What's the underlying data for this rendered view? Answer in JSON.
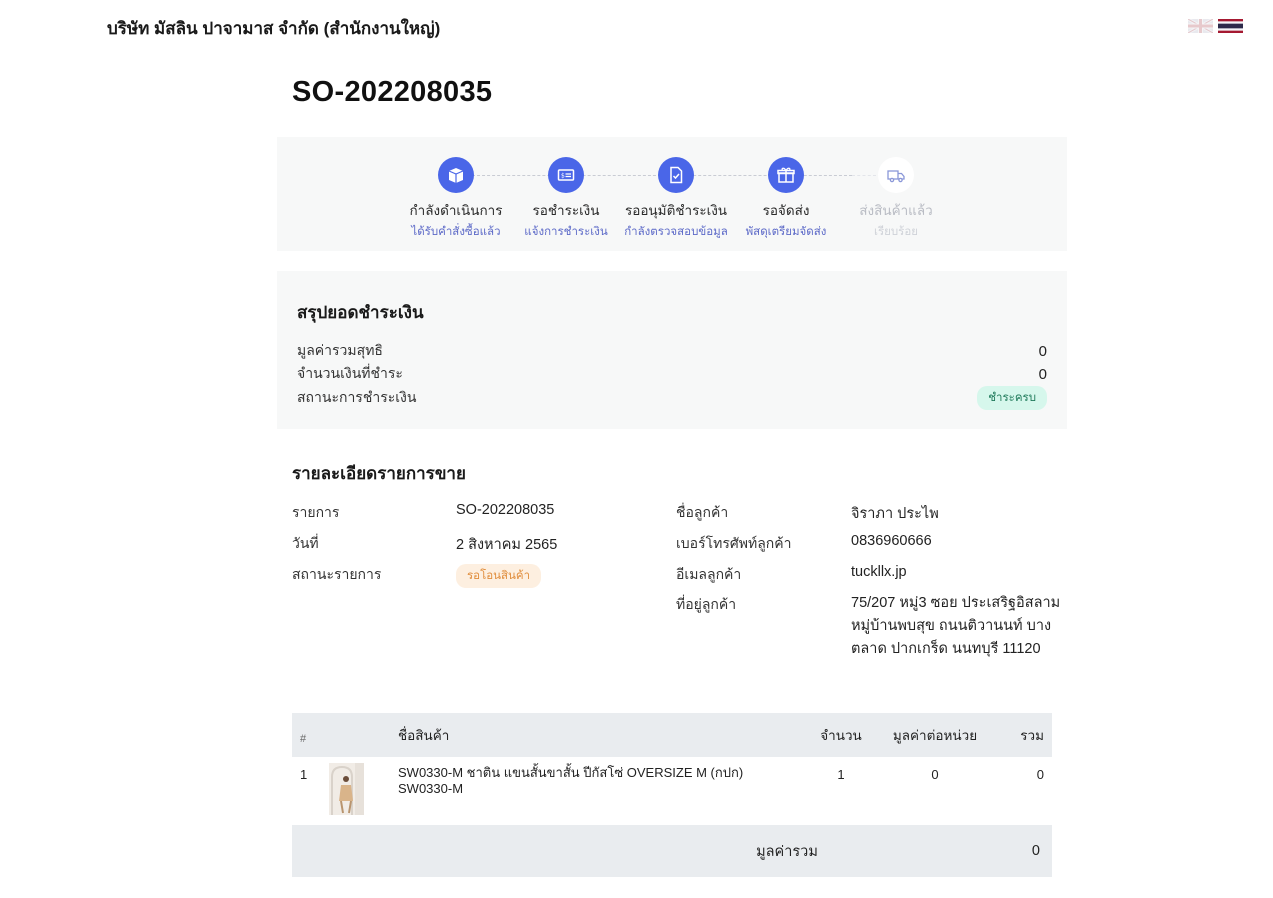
{
  "header": {
    "company": "บริษัท มัสลิน ปาจามาส จำกัด (สำนักงานใหญ่)",
    "flags": [
      "uk-flag-icon",
      "thai-flag-icon"
    ]
  },
  "order": {
    "number": "SO-202208035"
  },
  "steps": [
    {
      "label": "กำลังดำเนินการ",
      "sub": "ได้รับคำสั่งซื้อแล้ว",
      "icon": "box-icon",
      "active": true
    },
    {
      "label": "รอชำระเงิน",
      "sub": "แจ้งการชำระเงิน",
      "icon": "payment-card-icon",
      "active": true
    },
    {
      "label": "รออนุมัติชำระเงิน",
      "sub": "กำลังตรวจสอบข้อมูล",
      "icon": "document-check-icon",
      "active": true
    },
    {
      "label": "รอจัดส่ง",
      "sub": "พัสดุเตรียมจัดส่ง",
      "icon": "gift-box-icon",
      "active": true
    },
    {
      "label": "ส่งสินค้าแล้ว",
      "sub": "เรียบร้อย",
      "icon": "delivery-truck-icon",
      "active": false
    }
  ],
  "summary": {
    "title": "สรุปยอดชำระเงิน",
    "net_label": "มูลค่ารวมสุทธิ",
    "net_value": "0",
    "paid_label": "จำนวนเงินที่ชำระ",
    "paid_value": "0",
    "status_label": "สถานะการชำระเงิน",
    "status_value": "ชำระครบ",
    "status_color": "#d6f7ec"
  },
  "details": {
    "title": "รายละเอียดรายการขาย",
    "item_label": "รายการ",
    "item_value": "SO-202208035",
    "date_label": "วันที่",
    "date_value": "2 สิงหาคม 2565",
    "status_label": "สถานะรายการ",
    "status_value": "รอโอนสินค้า",
    "status_color": "#fdefe0",
    "customer_label": "ชื่อลูกค้า",
    "customer_value": "จิราภา ประไพ",
    "phone_label": "เบอร์โทรศัพท์ลูกค้า",
    "phone_value": "0836960666",
    "email_label": "อีเมลลูกค้า",
    "email_value": "tuckllx.jp",
    "address_label": "ที่อยู่ลูกค้า",
    "address_value": "75/207 หมู่3 ซอย ประเสริฐอิสลาม หมู่บ้านพบสุข ถนนติวานนท์ บางตลาด ปากเกร็ด นนทบุรี 11120"
  },
  "table": {
    "headers": {
      "index": "#",
      "name": "ชื่อสินค้า",
      "qty": "จำนวน",
      "unit_price": "มูลค่าต่อหน่วย",
      "total": "รวม"
    },
    "rows": [
      {
        "index": "1",
        "name": "SW0330-M ชาติน แขนสั้นขาสั้น ปีกัสโซ่ OVERSIZE M (กปก)",
        "sku": "SW0330-M",
        "qty": "1",
        "unit_price": "0",
        "total": "0"
      }
    ],
    "footer_label": "มูลค่ารวม",
    "footer_value": "0"
  },
  "colors": {
    "accent": "#4a66e8",
    "panel": "#f7f8f8",
    "table_header": "#e9ecef"
  }
}
